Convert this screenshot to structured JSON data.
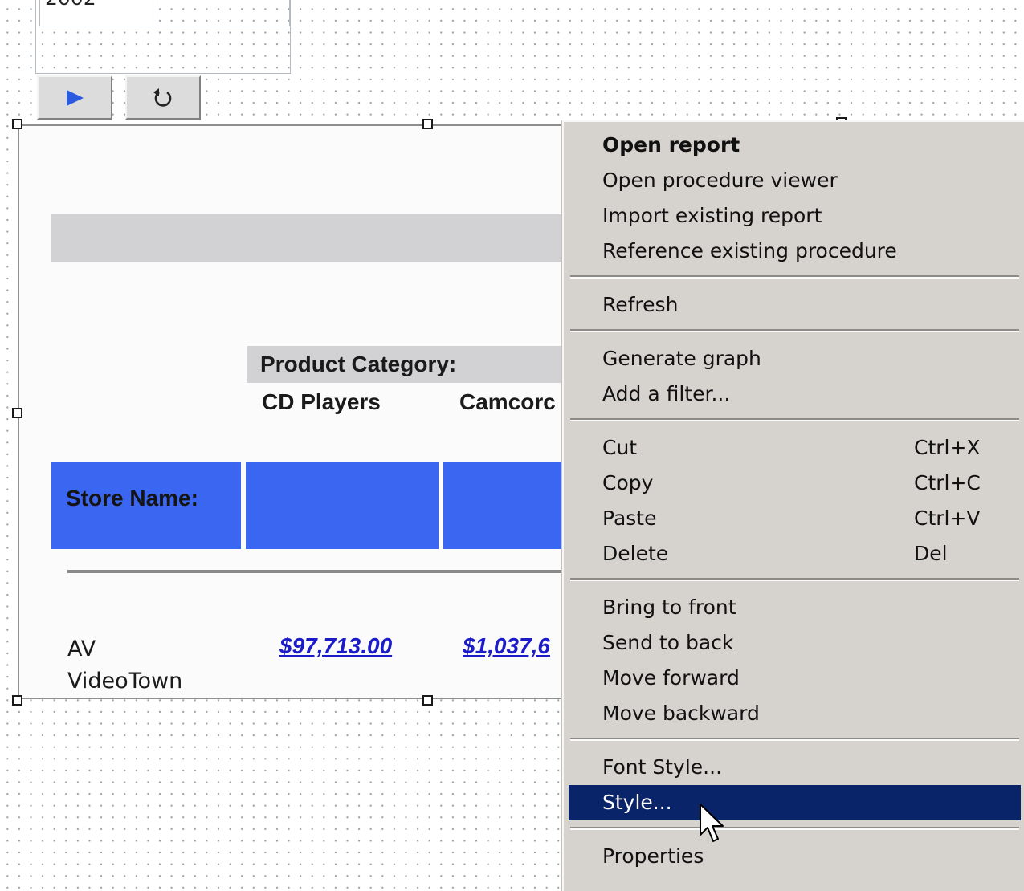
{
  "parameter_panel": {
    "year_value": "2002"
  },
  "toolbar": {
    "run_icon": "play-triangle-icon",
    "reset_icon": "refresh-arrow-icon"
  },
  "report": {
    "category_header": "Product Category:",
    "columns": [
      "CD Players",
      "Camcorc"
    ],
    "row_header": "Store Name:",
    "rows": [
      {
        "store": "AV VideoTown",
        "values": [
          "$97,713.00",
          "$1,037,6"
        ]
      }
    ],
    "colors": {
      "header_blue": "#3b66f2",
      "link_blue": "#1b1bc8",
      "gray_bar": "#d2d2d4"
    }
  },
  "context_menu": {
    "groups": [
      [
        {
          "label": "Open report",
          "bold": true
        },
        {
          "label": "Open procedure viewer"
        },
        {
          "label": "Import existing report"
        },
        {
          "label": "Reference existing procedure"
        }
      ],
      [
        {
          "label": "Refresh"
        }
      ],
      [
        {
          "label": "Generate graph"
        },
        {
          "label": "Add a filter..."
        }
      ],
      [
        {
          "label": "Cut",
          "shortcut": "Ctrl+X"
        },
        {
          "label": "Copy",
          "shortcut": "Ctrl+C"
        },
        {
          "label": "Paste",
          "shortcut": "Ctrl+V"
        },
        {
          "label": "Delete",
          "shortcut": "Del"
        }
      ],
      [
        {
          "label": "Bring to front"
        },
        {
          "label": "Send to back"
        },
        {
          "label": "Move forward"
        },
        {
          "label": "Move backward"
        }
      ],
      [
        {
          "label": "Font Style..."
        },
        {
          "label": "Style...",
          "highlighted": true
        }
      ],
      [
        {
          "label": "Properties"
        }
      ]
    ],
    "colors": {
      "background": "#d6d3ce",
      "highlight": "#0a246a"
    }
  }
}
